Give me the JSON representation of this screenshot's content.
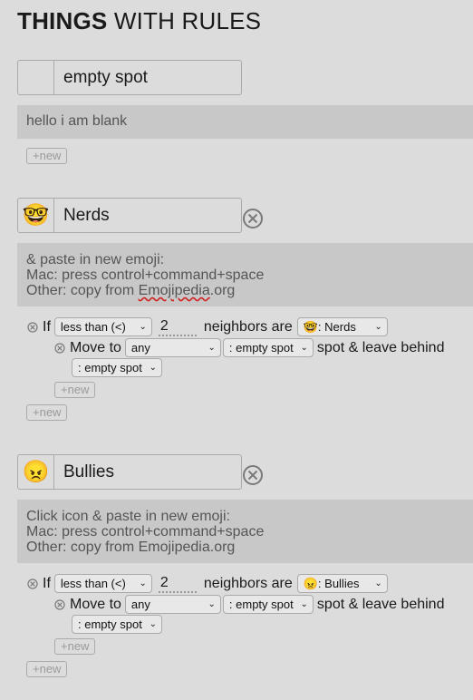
{
  "header": {
    "title_bold": "THINGS",
    "title_rest": " WITH RULES"
  },
  "things": [
    {
      "icon": "",
      "name": "empty spot",
      "description": [
        "hello i am blank"
      ],
      "new_label": "+new"
    },
    {
      "icon": "🤓",
      "name": "Nerds",
      "description": [
        "& paste in new emoji:",
        "Mac: press control+command+space",
        "Other: copy from ",
        "Emojipedia",
        ".org"
      ],
      "rule": {
        "if_label": "If",
        "comparison": "less than (<)",
        "count": "2",
        "neighbors_label": "neighbors are",
        "neighbor_type": "🤓: Nerds",
        "move_label": "Move to",
        "move_where": "any",
        "move_target": ": empty spot",
        "leave_label": "spot & leave behind",
        "leave_behind": ": empty spot",
        "inner_new_label": "+new"
      },
      "new_label": "+new"
    },
    {
      "icon": "😠",
      "name": "Bullies",
      "description": [
        "Click icon & paste in new emoji:",
        "Mac: press control+command+space",
        "Other: copy from Emojipedia.org"
      ],
      "rule": {
        "if_label": "If",
        "comparison": "less than (<)",
        "count": "2",
        "neighbors_label": "neighbors are",
        "neighbor_type": "😠: Bullies",
        "move_label": "Move to",
        "move_where": "any",
        "move_target": ": empty spot",
        "leave_label": "spot & leave behind",
        "leave_behind": ": empty spot",
        "inner_new_label": "+new"
      },
      "new_label": "+new"
    }
  ],
  "colors": {
    "background": "#dcdcdc",
    "description_bg": "#c8c8c8",
    "muted_text": "#9a9a9a"
  },
  "icons": {
    "remove": "circle-x-icon",
    "chevron": "chevron-down-icon"
  }
}
